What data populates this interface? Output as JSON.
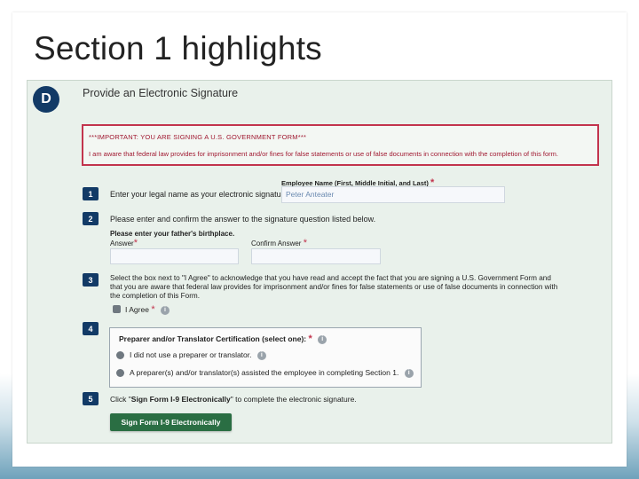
{
  "slide": {
    "title": "Section 1 highlights"
  },
  "form": {
    "badge": "D",
    "heading": "Provide an Electronic Signature",
    "warning": {
      "line1": "***IMPORTANT: YOU ARE SIGNING A U.S. GOVERNMENT FORM***",
      "line2": "I am aware that federal law provides for imprisonment and/or fines for false statements or use of false documents in connection with the completion of this form."
    },
    "step1": {
      "num": "1",
      "text": "Enter your legal name as your electronic signature:",
      "name_label": "Employee Name (First, Middle Initial, and Last)",
      "name_value": "Peter Anteater",
      "required": "*"
    },
    "step2": {
      "num": "2",
      "text": "Please enter and confirm the answer to the signature question listed below.",
      "question": "Please enter your father's birthplace.",
      "answer_label": "Answer",
      "confirm_label": "Confirm Answer",
      "required": "*"
    },
    "step3": {
      "num": "3",
      "line1": "Select the box next to \"I Agree\" to acknowledge that you have read and accept the fact that you are signing a U.S. Government Form and",
      "line2": "that you are aware that federal law provides for imprisonment and/or fines for false statements or use of false documents in connection with",
      "line3": "the completion of this Form.",
      "agree_label": "I Agree",
      "required": "*",
      "info": "i"
    },
    "step4": {
      "num": "4",
      "cert_title": "Preparer and/or Translator Certification (select one):",
      "required": "*",
      "info": "i",
      "option1": "I did not use a preparer or translator.",
      "option2": "A preparer(s) and/or translator(s) assisted the employee in completing Section 1."
    },
    "step5": {
      "num": "5",
      "text_prefix": "Click \"",
      "text_bold": "Sign Form I-9 Electronically",
      "text_suffix": "\" to complete the electronic signature.",
      "button": "Sign Form I-9 Electronically"
    }
  },
  "colors": {
    "badge": "#123a66",
    "warning_border": "#c2344d",
    "button": "#2a6e43",
    "form_bg": "#e9f1eb"
  }
}
